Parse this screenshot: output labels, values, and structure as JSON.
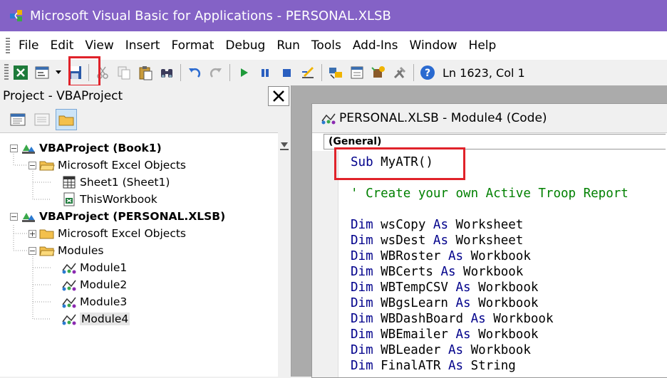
{
  "window": {
    "title": "Microsoft Visual Basic for Applications - PERSONAL.XLSB"
  },
  "menu": [
    "File",
    "Edit",
    "View",
    "Insert",
    "Format",
    "Debug",
    "Run",
    "Tools",
    "Add-Ins",
    "Window",
    "Help"
  ],
  "toolbar": {
    "cursor_position": "Ln 1623, Col 1"
  },
  "project": {
    "title": "Project - VBAProject",
    "tree": {
      "book1": "VBAProject (Book1)",
      "book1_excel_objects": "Microsoft Excel Objects",
      "sheet1": "Sheet1 (Sheet1)",
      "thisworkbook": "ThisWorkbook",
      "personal": "VBAProject (PERSONAL.XLSB)",
      "personal_excel_objects": "Microsoft Excel Objects",
      "modules": "Modules",
      "module1": "Module1",
      "module2": "Module2",
      "module3": "Module3",
      "module4": "Module4"
    }
  },
  "code_window": {
    "title": "PERSONAL.XLSB - Module4 (Code)",
    "object_combo": "(General)",
    "sub_kw": "Sub",
    "sub_name": " MyATR()",
    "comment": "' Create your own Active Troop Report",
    "dims": [
      {
        "kw1": "Dim",
        "name": " wsCopy ",
        "kw2": "As",
        "type": " Worksheet"
      },
      {
        "kw1": "Dim",
        "name": " wsDest ",
        "kw2": "As",
        "type": " Worksheet"
      },
      {
        "kw1": "Dim",
        "name": " WBRoster ",
        "kw2": "As",
        "type": " Workbook"
      },
      {
        "kw1": "Dim",
        "name": " WBCerts ",
        "kw2": "As",
        "type": " Workbook"
      },
      {
        "kw1": "Dim",
        "name": " WBTempCSV ",
        "kw2": "As",
        "type": " Workbook"
      },
      {
        "kw1": "Dim",
        "name": " WBgsLearn ",
        "kw2": "As",
        "type": " Workbook"
      },
      {
        "kw1": "Dim",
        "name": " WBDashBoard ",
        "kw2": "As",
        "type": " Workbook"
      },
      {
        "kw1": "Dim",
        "name": " WBEmailer ",
        "kw2": "As",
        "type": " Workbook"
      },
      {
        "kw1": "Dim",
        "name": " WBLeader ",
        "kw2": "As",
        "type": " Workbook"
      },
      {
        "kw1": "Dim",
        "name": " FinalATR ",
        "kw2": "As",
        "type": " String"
      }
    ]
  },
  "colors": {
    "titlebar": "#8462c6",
    "highlight": "#e0222a",
    "keyword": "#00008b",
    "comment": "#008000"
  }
}
